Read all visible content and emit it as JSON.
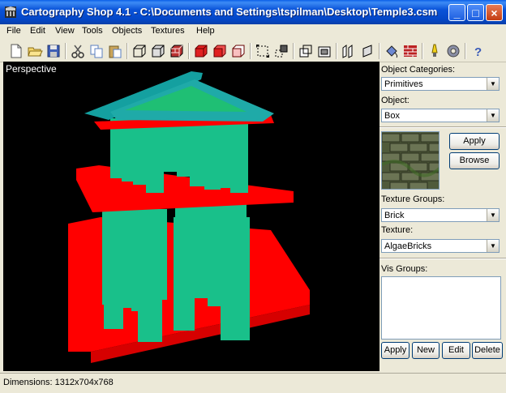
{
  "window": {
    "title": "Cartography Shop 4.1 - C:\\Documents and Settings\\tspilman\\Desktop\\Temple3.csm",
    "minimize_label": "_",
    "maximize_label": "□",
    "close_label": "×"
  },
  "menu": [
    "File",
    "Edit",
    "View",
    "Tools",
    "Objects",
    "Textures",
    "Help"
  ],
  "toolbar_icons": [
    "new-icon",
    "open-icon",
    "save-icon",
    "cut-icon",
    "copy-icon",
    "paste-icon",
    "box-wire-icon",
    "box-solid-icon",
    "box-textured-icon",
    "red-box-icon",
    "red-box-open-icon",
    "red-box-outline-icon",
    "scale-icon",
    "move-icon",
    "rotate-icon",
    "flip-icon",
    "group-icon",
    "ungroup-icon",
    "paint-icon",
    "brick-icon",
    "light-icon",
    "settings-icon",
    "help-icon"
  ],
  "viewport": {
    "label": "Perspective",
    "colors": {
      "column": "#1fbf8f",
      "slab": "#ff0000",
      "roof": "#1f9f9f"
    }
  },
  "panel": {
    "object_categories_label": "Object Categories:",
    "object_categories_value": "Primitives",
    "object_label": "Object:",
    "object_value": "Box",
    "apply_label": "Apply",
    "browse_label": "Browse",
    "texture_groups_label": "Texture Groups:",
    "texture_groups_value": "Brick",
    "texture_label": "Texture:",
    "texture_value": "AlgaeBricks",
    "vis_groups_label": "Vis Groups:",
    "vis_buttons": [
      "Apply",
      "New",
      "Edit",
      "Delete"
    ]
  },
  "status": {
    "dimensions": "Dimensions: 1312x704x768"
  }
}
